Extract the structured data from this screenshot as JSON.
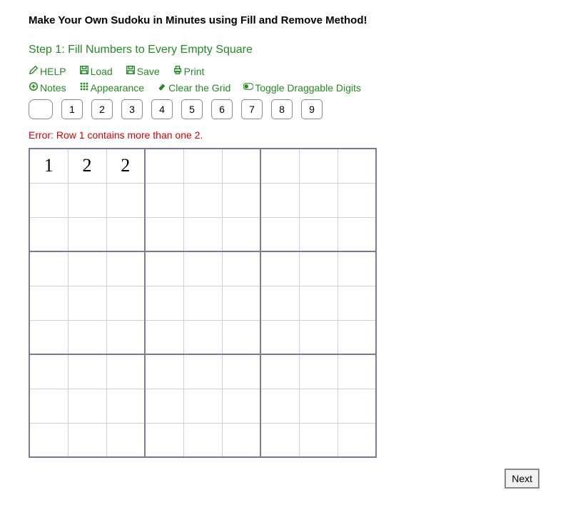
{
  "title": "Make Your Own Sudoku in Minutes using Fill and Remove Method!",
  "step": "Step 1: Fill Numbers to Every Empty Square",
  "toolbar1": {
    "help": "HELP",
    "load": "Load",
    "save": "Save",
    "print": "Print"
  },
  "toolbar2": {
    "notes": "Notes",
    "appearance": "Appearance",
    "clear": "Clear the Grid",
    "toggle": "Toggle Draggable Digits"
  },
  "digits": [
    "1",
    "2",
    "3",
    "4",
    "5",
    "6",
    "7",
    "8",
    "9"
  ],
  "error": "Error: Row 1 contains more than one 2.",
  "grid": [
    [
      "1",
      "2",
      "2",
      "",
      "",
      "",
      "",
      "",
      ""
    ],
    [
      "",
      "",
      "",
      "",
      "",
      "",
      "",
      "",
      ""
    ],
    [
      "",
      "",
      "",
      "",
      "",
      "",
      "",
      "",
      ""
    ],
    [
      "",
      "",
      "",
      "",
      "",
      "",
      "",
      "",
      ""
    ],
    [
      "",
      "",
      "",
      "",
      "",
      "",
      "",
      "",
      ""
    ],
    [
      "",
      "",
      "",
      "",
      "",
      "",
      "",
      "",
      ""
    ],
    [
      "",
      "",
      "",
      "",
      "",
      "",
      "",
      "",
      ""
    ],
    [
      "",
      "",
      "",
      "",
      "",
      "",
      "",
      "",
      ""
    ],
    [
      "",
      "",
      "",
      "",
      "",
      "",
      "",
      "",
      ""
    ]
  ],
  "next": "Next"
}
